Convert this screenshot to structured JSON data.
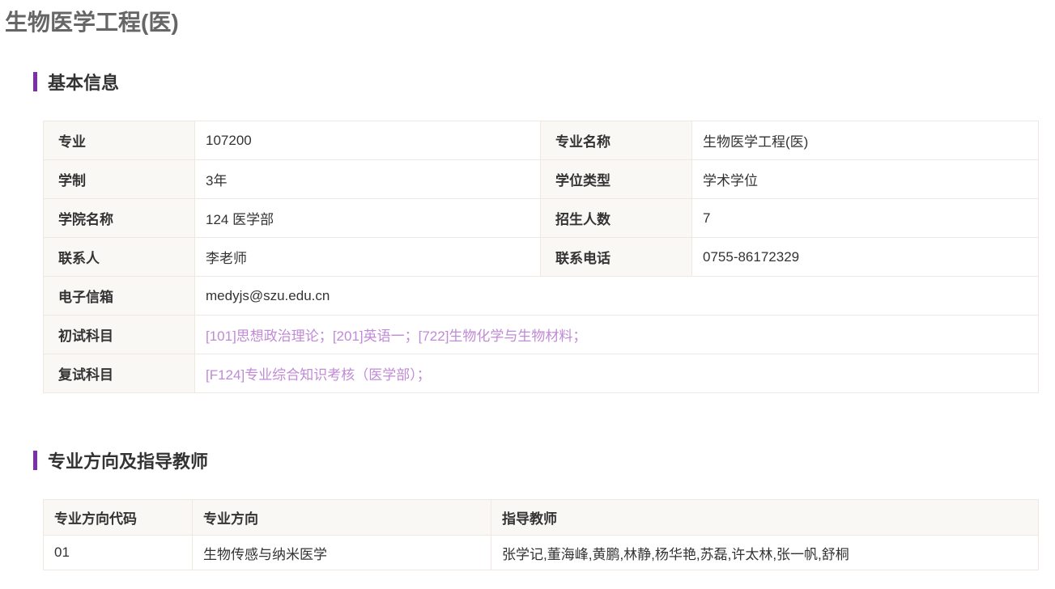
{
  "page_title": "生物医学工程(医)",
  "sections": {
    "basic_info": {
      "heading": "基本信息",
      "rows": [
        {
          "label1": "专业",
          "value1": "107200",
          "label2": "专业名称",
          "value2": "生物医学工程(医)"
        },
        {
          "label1": "学制",
          "value1": "3年",
          "label2": "学位类型",
          "value2": "学术学位"
        },
        {
          "label1": "学院名称",
          "value1": "124 医学部",
          "label2": "招生人数",
          "value2": "7"
        },
        {
          "label1": "联系人",
          "value1": "李老师",
          "label2": "联系电话",
          "value2": "0755-86172329"
        }
      ],
      "email": {
        "label": "电子信箱",
        "value": "medyjs@szu.edu.cn"
      },
      "initial_exam": {
        "label": "初试科目",
        "subjects": [
          "[101]思想政治理论；",
          "[201]英语一；",
          "[722]生物化学与生物材料；"
        ]
      },
      "retest_exam": {
        "label": "复试科目",
        "subjects": [
          "[F124]专业综合知识考核（医学部）；"
        ]
      }
    },
    "direction": {
      "heading": "专业方向及指导教师",
      "columns": [
        "专业方向代码",
        "专业方向",
        "指导教师"
      ],
      "rows": [
        {
          "code": "01",
          "direction": "生物传感与纳米医学",
          "advisors": "张学记,董海峰,黄鹏,林静,杨华艳,苏磊,许太林,张一帆,舒桐"
        }
      ]
    }
  },
  "colors": {
    "accent": "#7b2fa8",
    "link": "#c08ad6",
    "label_bg": "#faf8f4",
    "border": "#f0e8e0",
    "title": "#666666"
  }
}
